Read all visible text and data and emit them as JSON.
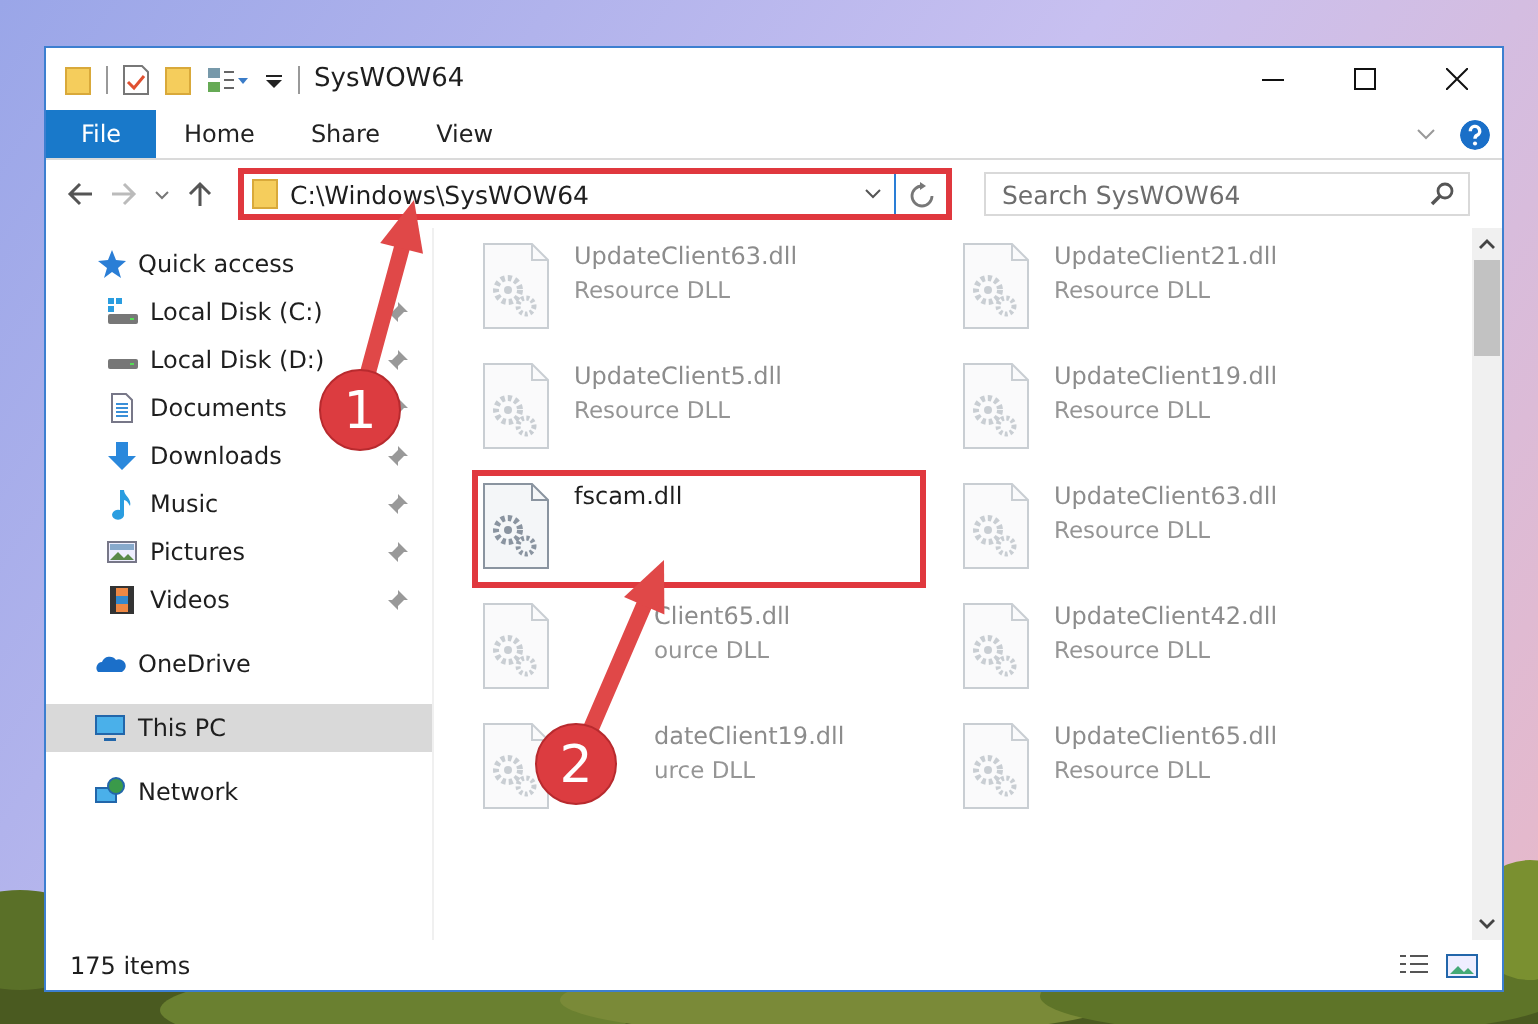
{
  "window": {
    "title": "SysWOW64"
  },
  "ribbon": {
    "file_button": "File",
    "tabs": [
      "Home",
      "Share",
      "View"
    ]
  },
  "address_bar": {
    "path": "C:\\Windows\\SysWOW64",
    "highlighted": true
  },
  "search": {
    "placeholder": "Search SysWOW64"
  },
  "nav_pane": [
    {
      "label": "Quick access",
      "kind": "star",
      "selected": false,
      "children": [
        {
          "label": "Local Disk (C:)",
          "kind": "systemdrive",
          "pinned": true,
          "selected": false
        },
        {
          "label": "Local Disk (D:)",
          "kind": "drive",
          "pinned": true,
          "selected": false
        },
        {
          "label": "Documents",
          "kind": "document",
          "pinned": true,
          "selected": false
        },
        {
          "label": "Downloads",
          "kind": "download",
          "pinned": true,
          "selected": false
        },
        {
          "label": "Music",
          "kind": "music",
          "pinned": true,
          "selected": false
        },
        {
          "label": "Pictures",
          "kind": "pictures",
          "pinned": true,
          "selected": false
        },
        {
          "label": "Videos",
          "kind": "videos",
          "pinned": true,
          "selected": false
        }
      ]
    },
    {
      "label": "OneDrive",
      "kind": "cloud",
      "selected": false
    },
    {
      "label": "This PC",
      "kind": "pc",
      "selected": true
    },
    {
      "label": "Network",
      "kind": "network",
      "selected": false
    }
  ],
  "files": [
    {
      "name": "UpdateClient63.dll",
      "type": "Resource DLL",
      "blurred": true,
      "highlighted": false
    },
    {
      "name": "UpdateClient21.dll",
      "type": "Resource DLL",
      "blurred": true,
      "highlighted": false
    },
    {
      "name": "UpdateClient5.dll",
      "type": "Resource DLL",
      "blurred": true,
      "highlighted": false
    },
    {
      "name": "UpdateClient19.dll",
      "type": "Resource DLL",
      "blurred": true,
      "highlighted": false
    },
    {
      "name": "fscam.dll",
      "blurred": false,
      "highlighted": true
    },
    {
      "name": "UpdateClient63.dll",
      "type": "Resource DLL",
      "blurred": true,
      "highlighted": false
    },
    {
      "name": "Client65.dll",
      "type": "ource DLL",
      "blurred": true,
      "highlighted": false,
      "covered": true
    },
    {
      "name": "UpdateClient42.dll",
      "type": "Resource DLL",
      "blurred": true,
      "highlighted": false
    },
    {
      "name": "dateClient19.dll",
      "type": "urce DLL",
      "blurred": true,
      "highlighted": false,
      "covered": true
    },
    {
      "name": "UpdateClient65.dll",
      "type": "Resource DLL",
      "blurred": true,
      "highlighted": false
    }
  ],
  "status_bar": {
    "item_count": "175 items"
  },
  "callouts": [
    {
      "number": "1"
    },
    {
      "number": "2"
    }
  ]
}
